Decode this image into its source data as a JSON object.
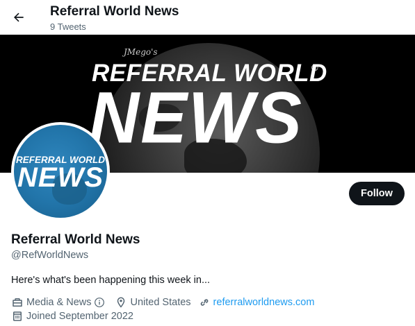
{
  "header": {
    "title": "Referral World News",
    "subtitle": "9 Tweets"
  },
  "banner": {
    "signature": "JMego's",
    "line1": "REFERRAL WORLD",
    "registered": "®",
    "line2": "NEWS"
  },
  "avatar": {
    "line1": "REFERRAL WORLD",
    "line2": "NEWS"
  },
  "actions": {
    "follow_label": "Follow"
  },
  "profile": {
    "name": "Referral World News",
    "handle": "@RefWorldNews",
    "bio": "Here's what's been happening this week in...",
    "category": "Media & News",
    "location": "United States",
    "website": "referralworldnews.com",
    "joined": "Joined September 2022"
  },
  "colors": {
    "text_primary": "#0f1419",
    "text_secondary": "#536471",
    "link": "#1d9bf0",
    "follow_bg": "#0f1419",
    "avatar_blue": "#2275aa"
  },
  "icons": {
    "back": "arrow-left-icon",
    "category": "briefcase-icon",
    "info": "info-icon",
    "location": "location-pin-icon",
    "link": "link-icon",
    "calendar": "calendar-icon"
  }
}
